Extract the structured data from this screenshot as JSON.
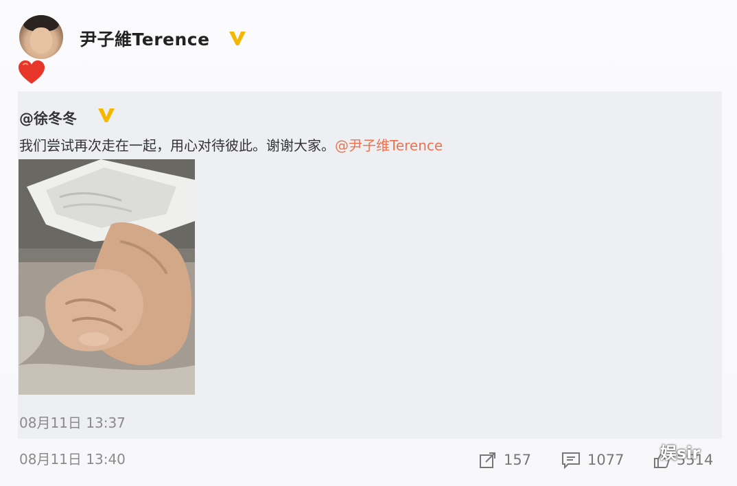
{
  "post": {
    "author_name": "尹子維Terence",
    "verified_icon": "verified-v-badge-icon",
    "emoji_icon": "red-heart-icon",
    "timestamp": "08月11日 13:40"
  },
  "repost": {
    "author_handle": "@徐冬冬",
    "text_body": "我们尝试再次走在一起，用心对待彼此。谢谢大家。",
    "mention": "@尹子维Terence",
    "photo_icon": "holding-hands-photo",
    "timestamp": "08月11日 13:37"
  },
  "actions": {
    "share_count": "157",
    "comment_count": "1077",
    "like_count": "5514"
  },
  "watermark": {
    "text": "娱sir"
  },
  "colors": {
    "mention": "#eb7350",
    "verified_badge": "#f5b800",
    "repost_background": "#eeeff3",
    "meta_text": "#8a8a8a"
  }
}
